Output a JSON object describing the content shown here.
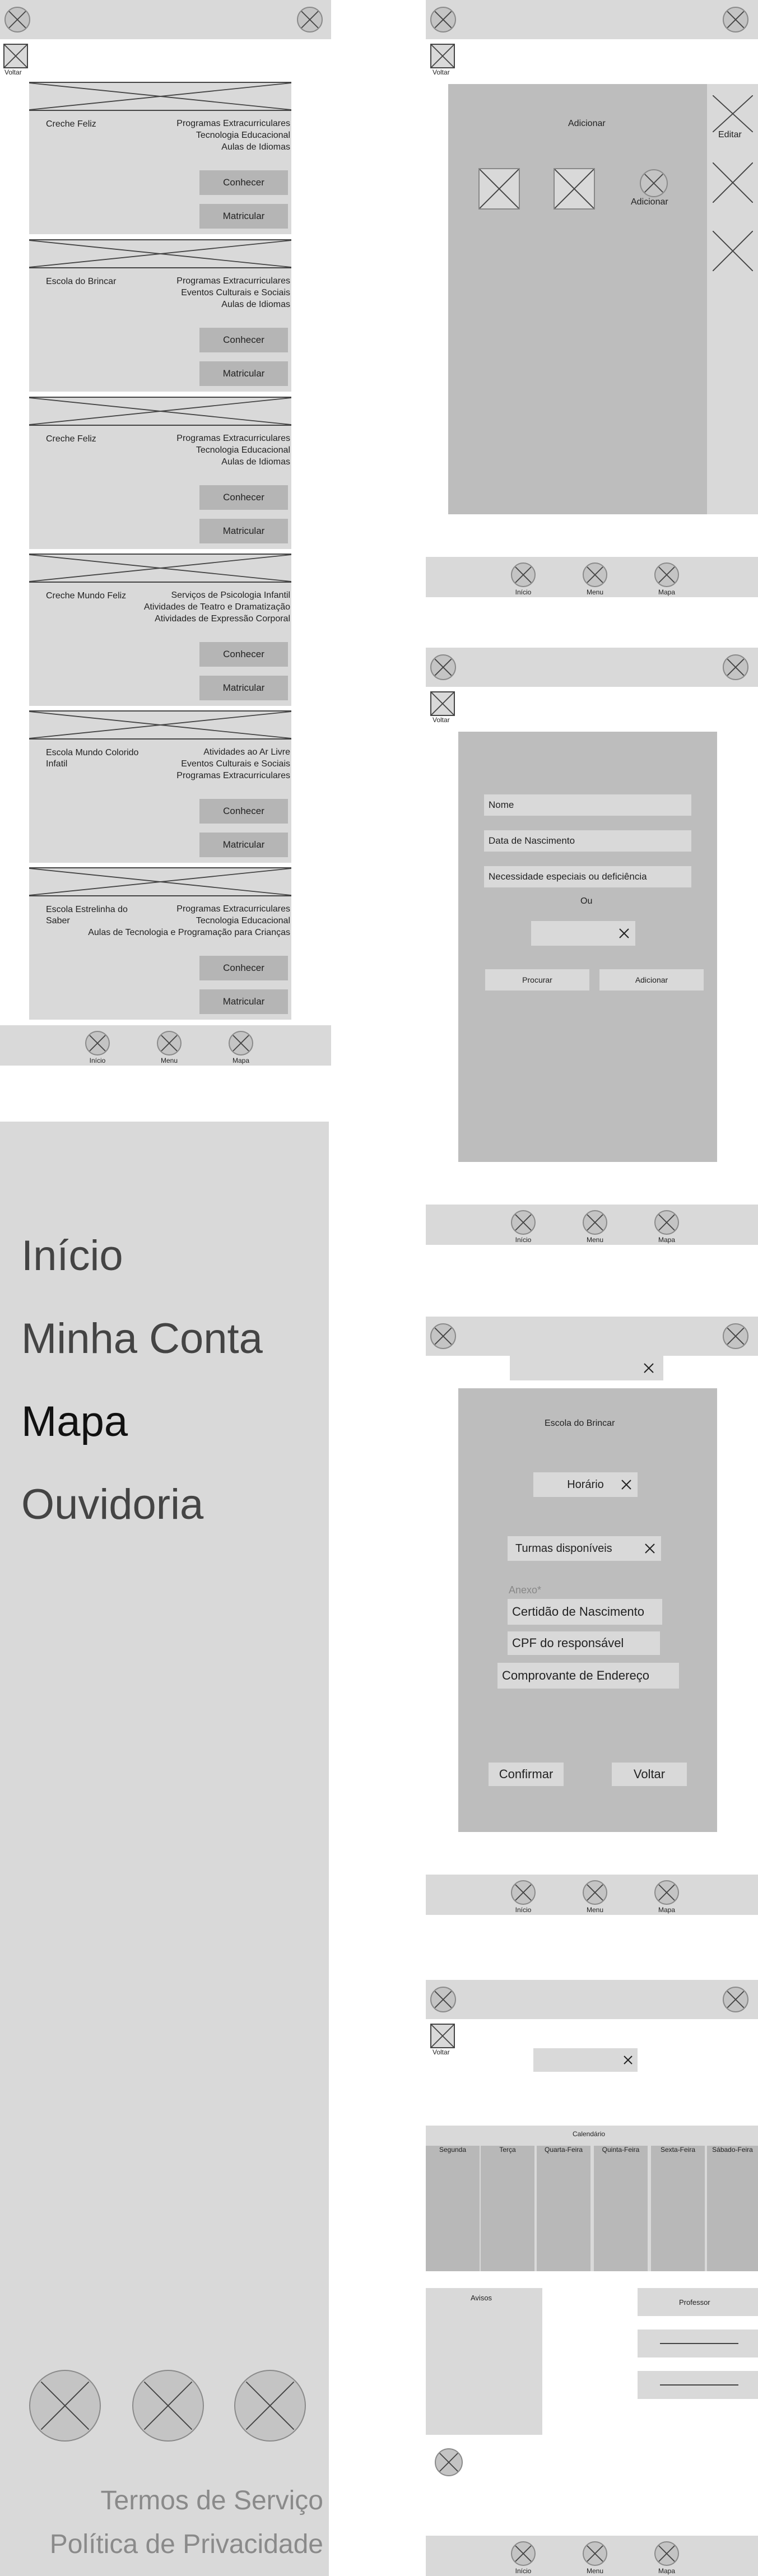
{
  "common": {
    "back_label": "Voltar",
    "nav": [
      "Início",
      "Menu",
      "Mapa"
    ]
  },
  "schools": [
    {
      "name": "Creche Feliz",
      "features": [
        "Programas Extracurriculares",
        "Tecnologia Educacional",
        "Aulas de Idiomas"
      ]
    },
    {
      "name": "Escola do Brincar",
      "features": [
        "Programas Extracurriculares",
        "Eventos Culturais e Sociais",
        "Aulas de Idiomas"
      ]
    },
    {
      "name": "Creche Feliz",
      "features": [
        "Programas Extracurriculares",
        "Tecnologia Educacional",
        "Aulas de Idiomas"
      ]
    },
    {
      "name": "Creche Mundo Feliz",
      "features": [
        "Serviços de Psicologia Infantil",
        "Atividades de Teatro e Dramatização",
        "Atividades de Expressão Corporal"
      ]
    },
    {
      "name": "Escola Mundo Colorido Infatil",
      "features": [
        "Atividades ao Ar Livre",
        "Eventos Culturais e Sociais",
        "Programas Extracurriculares"
      ]
    },
    {
      "name": "Escola Estrelinha do Saber",
      "features": [
        "Programas Extracurriculares",
        "Tecnologia Educacional",
        "Aulas de Tecnologia e Programação para Crianças"
      ]
    }
  ],
  "school_buttons": {
    "know": "Conhecer",
    "enroll": "Matricular"
  },
  "menu": {
    "items": [
      "Início",
      "Minha Conta",
      "Mapa",
      "Ouvidoria"
    ],
    "terms": "Termos de Serviço",
    "privacy": "Política de Privacidade"
  },
  "children_screen": {
    "title": "Adicionar",
    "add_label": "Adicionar",
    "edit_label": "Editar"
  },
  "add_child_form": {
    "name": "Nome",
    "birth": "Data de Nascimento",
    "special_needs": "Necessidade especiais ou deficiência",
    "or": "Ou",
    "search_button": "Procurar",
    "add_button": "Adicionar"
  },
  "enroll_screen": {
    "school": "Escola do Brincar",
    "schedule": "Horário",
    "classes": "Turmas disponíveis",
    "attachment_label": "Anexo*",
    "docs": [
      "Certidão de Nascimento",
      "CPF do responsável",
      "Comprovante de Endereço"
    ],
    "confirm": "Confirmar",
    "back": "Voltar"
  },
  "calendar_screen": {
    "calendar_title": "Calendário",
    "days": [
      "Segunda",
      "Terça",
      "Quarta-Feira",
      "Quinta-Feira",
      "Sexta-Feira",
      "Sábado-Feira"
    ],
    "notices_title": "Avisos",
    "teacher_label": "Professor"
  }
}
